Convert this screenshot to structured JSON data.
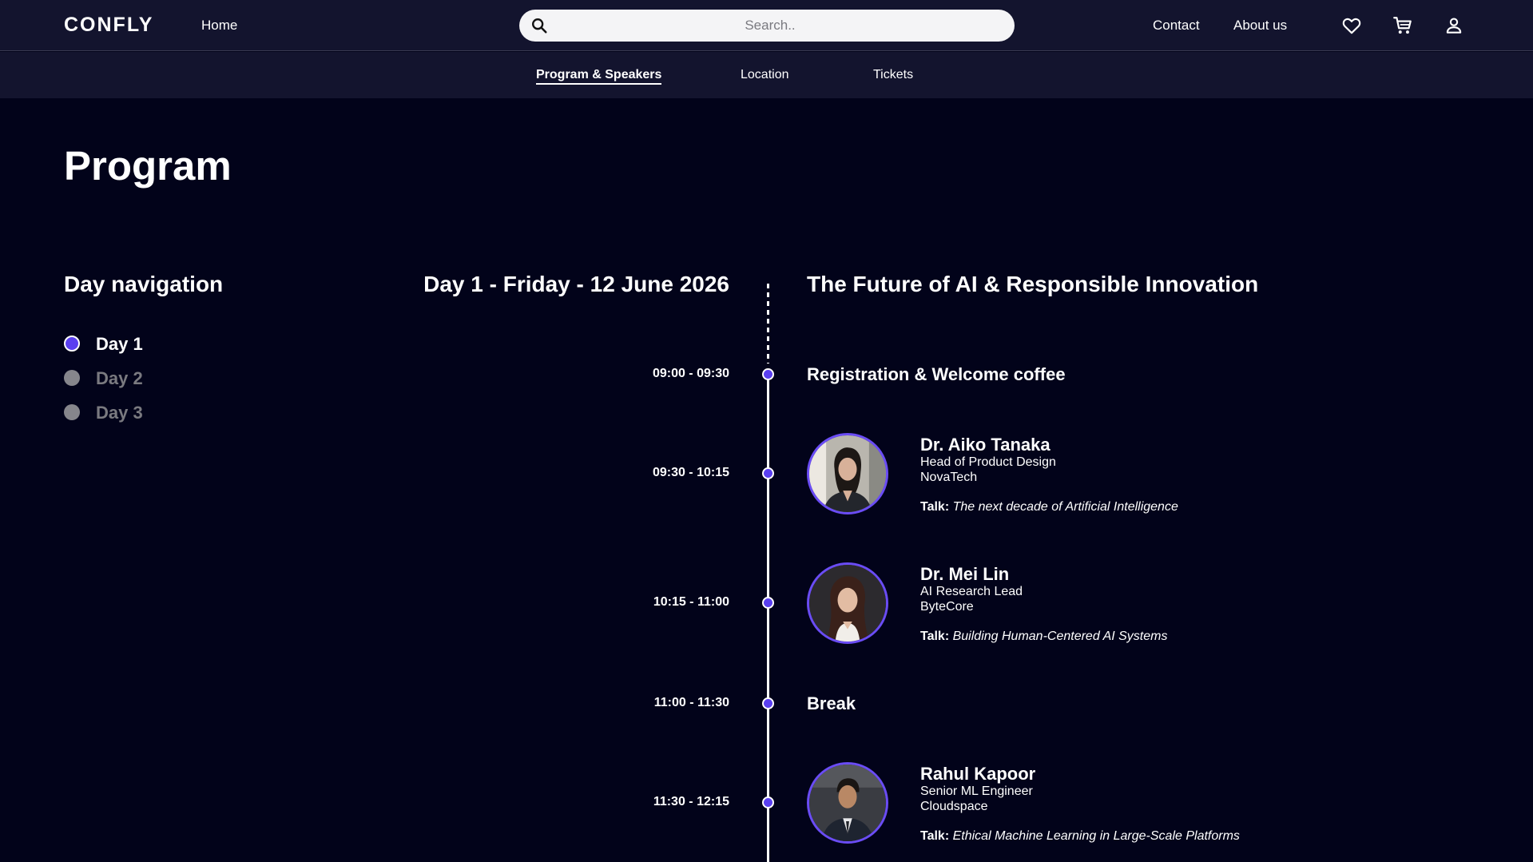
{
  "header": {
    "logo": "CONFLY",
    "home": "Home",
    "search_placeholder": "Search..",
    "contact": "Contact",
    "about": "About us",
    "icons": [
      "heart-icon",
      "cart-icon",
      "user-icon"
    ]
  },
  "subnav": {
    "items": [
      {
        "label": "Program & Speakers",
        "active": true
      },
      {
        "label": "Location",
        "active": false
      },
      {
        "label": "Tickets",
        "active": false
      }
    ]
  },
  "page": {
    "title": "Program"
  },
  "day_navigation": {
    "title": "Day navigation",
    "days": [
      {
        "label": "Day 1",
        "active": true
      },
      {
        "label": "Day 2",
        "active": false
      },
      {
        "label": "Day 3",
        "active": false
      }
    ]
  },
  "schedule": {
    "day_heading": "Day 1 - Friday - 12 June 2026",
    "theme": "The Future of AI & Responsible Innovation",
    "talk_prefix": "Talk:",
    "slots": [
      {
        "time": "09:00 - 09:30",
        "title": "Registration & Welcome coffee"
      },
      {
        "time": "09:30 - 10:15",
        "speaker": {
          "name": "Dr. Aiko Tanaka",
          "role": "Head of Product Design",
          "company": "NovaTech",
          "talk": "The next decade of Artificial Intelligence"
        }
      },
      {
        "time": "10:15 - 11:00",
        "speaker": {
          "name": "Dr. Mei Lin",
          "role": "AI Research Lead",
          "company": "ByteCore",
          "talk": "Building Human-Centered AI Systems"
        }
      },
      {
        "time": "11:00 - 11:30",
        "title": "Break"
      },
      {
        "time": "11:30 - 12:15",
        "speaker": {
          "name": "Rahul Kapoor",
          "role": "Senior ML Engineer",
          "company": "Cloudspace",
          "talk": "Ethical Machine Learning in Large-Scale Platforms"
        }
      }
    ]
  },
  "colors": {
    "background": "#02031a",
    "nav_background": "#13142e",
    "accent": "#5a3ff0",
    "inactive": "#7a7a80"
  }
}
